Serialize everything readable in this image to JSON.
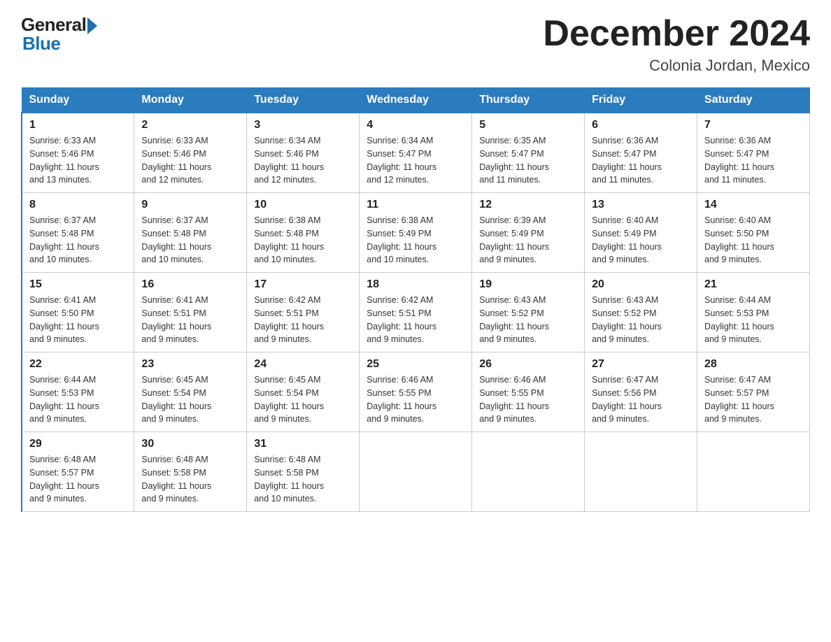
{
  "logo": {
    "general": "General",
    "blue": "Blue"
  },
  "title": "December 2024",
  "location": "Colonia Jordan, Mexico",
  "days_of_week": [
    "Sunday",
    "Monday",
    "Tuesday",
    "Wednesday",
    "Thursday",
    "Friday",
    "Saturday"
  ],
  "weeks": [
    [
      {
        "day": "1",
        "sunrise": "6:33 AM",
        "sunset": "5:46 PM",
        "daylight": "11 hours and 13 minutes."
      },
      {
        "day": "2",
        "sunrise": "6:33 AM",
        "sunset": "5:46 PM",
        "daylight": "11 hours and 12 minutes."
      },
      {
        "day": "3",
        "sunrise": "6:34 AM",
        "sunset": "5:46 PM",
        "daylight": "11 hours and 12 minutes."
      },
      {
        "day": "4",
        "sunrise": "6:34 AM",
        "sunset": "5:47 PM",
        "daylight": "11 hours and 12 minutes."
      },
      {
        "day": "5",
        "sunrise": "6:35 AM",
        "sunset": "5:47 PM",
        "daylight": "11 hours and 11 minutes."
      },
      {
        "day": "6",
        "sunrise": "6:36 AM",
        "sunset": "5:47 PM",
        "daylight": "11 hours and 11 minutes."
      },
      {
        "day": "7",
        "sunrise": "6:36 AM",
        "sunset": "5:47 PM",
        "daylight": "11 hours and 11 minutes."
      }
    ],
    [
      {
        "day": "8",
        "sunrise": "6:37 AM",
        "sunset": "5:48 PM",
        "daylight": "11 hours and 10 minutes."
      },
      {
        "day": "9",
        "sunrise": "6:37 AM",
        "sunset": "5:48 PM",
        "daylight": "11 hours and 10 minutes."
      },
      {
        "day": "10",
        "sunrise": "6:38 AM",
        "sunset": "5:48 PM",
        "daylight": "11 hours and 10 minutes."
      },
      {
        "day": "11",
        "sunrise": "6:38 AM",
        "sunset": "5:49 PM",
        "daylight": "11 hours and 10 minutes."
      },
      {
        "day": "12",
        "sunrise": "6:39 AM",
        "sunset": "5:49 PM",
        "daylight": "11 hours and 9 minutes."
      },
      {
        "day": "13",
        "sunrise": "6:40 AM",
        "sunset": "5:49 PM",
        "daylight": "11 hours and 9 minutes."
      },
      {
        "day": "14",
        "sunrise": "6:40 AM",
        "sunset": "5:50 PM",
        "daylight": "11 hours and 9 minutes."
      }
    ],
    [
      {
        "day": "15",
        "sunrise": "6:41 AM",
        "sunset": "5:50 PM",
        "daylight": "11 hours and 9 minutes."
      },
      {
        "day": "16",
        "sunrise": "6:41 AM",
        "sunset": "5:51 PM",
        "daylight": "11 hours and 9 minutes."
      },
      {
        "day": "17",
        "sunrise": "6:42 AM",
        "sunset": "5:51 PM",
        "daylight": "11 hours and 9 minutes."
      },
      {
        "day": "18",
        "sunrise": "6:42 AM",
        "sunset": "5:51 PM",
        "daylight": "11 hours and 9 minutes."
      },
      {
        "day": "19",
        "sunrise": "6:43 AM",
        "sunset": "5:52 PM",
        "daylight": "11 hours and 9 minutes."
      },
      {
        "day": "20",
        "sunrise": "6:43 AM",
        "sunset": "5:52 PM",
        "daylight": "11 hours and 9 minutes."
      },
      {
        "day": "21",
        "sunrise": "6:44 AM",
        "sunset": "5:53 PM",
        "daylight": "11 hours and 9 minutes."
      }
    ],
    [
      {
        "day": "22",
        "sunrise": "6:44 AM",
        "sunset": "5:53 PM",
        "daylight": "11 hours and 9 minutes."
      },
      {
        "day": "23",
        "sunrise": "6:45 AM",
        "sunset": "5:54 PM",
        "daylight": "11 hours and 9 minutes."
      },
      {
        "day": "24",
        "sunrise": "6:45 AM",
        "sunset": "5:54 PM",
        "daylight": "11 hours and 9 minutes."
      },
      {
        "day": "25",
        "sunrise": "6:46 AM",
        "sunset": "5:55 PM",
        "daylight": "11 hours and 9 minutes."
      },
      {
        "day": "26",
        "sunrise": "6:46 AM",
        "sunset": "5:55 PM",
        "daylight": "11 hours and 9 minutes."
      },
      {
        "day": "27",
        "sunrise": "6:47 AM",
        "sunset": "5:56 PM",
        "daylight": "11 hours and 9 minutes."
      },
      {
        "day": "28",
        "sunrise": "6:47 AM",
        "sunset": "5:57 PM",
        "daylight": "11 hours and 9 minutes."
      }
    ],
    [
      {
        "day": "29",
        "sunrise": "6:48 AM",
        "sunset": "5:57 PM",
        "daylight": "11 hours and 9 minutes."
      },
      {
        "day": "30",
        "sunrise": "6:48 AM",
        "sunset": "5:58 PM",
        "daylight": "11 hours and 9 minutes."
      },
      {
        "day": "31",
        "sunrise": "6:48 AM",
        "sunset": "5:58 PM",
        "daylight": "11 hours and 10 minutes."
      },
      null,
      null,
      null,
      null
    ]
  ],
  "labels": {
    "sunrise": "Sunrise:",
    "sunset": "Sunset:",
    "daylight": "Daylight:"
  }
}
